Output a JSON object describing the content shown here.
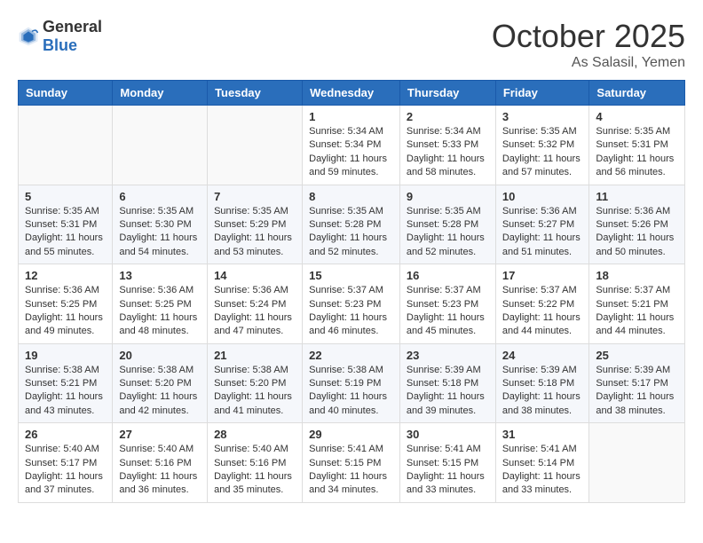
{
  "header": {
    "logo_general": "General",
    "logo_blue": "Blue",
    "month": "October 2025",
    "location": "As Salasil, Yemen"
  },
  "weekdays": [
    "Sunday",
    "Monday",
    "Tuesday",
    "Wednesday",
    "Thursday",
    "Friday",
    "Saturday"
  ],
  "weeks": [
    [
      {
        "day": "",
        "info": ""
      },
      {
        "day": "",
        "info": ""
      },
      {
        "day": "",
        "info": ""
      },
      {
        "day": "1",
        "info": "Sunrise: 5:34 AM\nSunset: 5:34 PM\nDaylight: 11 hours and 59 minutes."
      },
      {
        "day": "2",
        "info": "Sunrise: 5:34 AM\nSunset: 5:33 PM\nDaylight: 11 hours and 58 minutes."
      },
      {
        "day": "3",
        "info": "Sunrise: 5:35 AM\nSunset: 5:32 PM\nDaylight: 11 hours and 57 minutes."
      },
      {
        "day": "4",
        "info": "Sunrise: 5:35 AM\nSunset: 5:31 PM\nDaylight: 11 hours and 56 minutes."
      }
    ],
    [
      {
        "day": "5",
        "info": "Sunrise: 5:35 AM\nSunset: 5:31 PM\nDaylight: 11 hours and 55 minutes."
      },
      {
        "day": "6",
        "info": "Sunrise: 5:35 AM\nSunset: 5:30 PM\nDaylight: 11 hours and 54 minutes."
      },
      {
        "day": "7",
        "info": "Sunrise: 5:35 AM\nSunset: 5:29 PM\nDaylight: 11 hours and 53 minutes."
      },
      {
        "day": "8",
        "info": "Sunrise: 5:35 AM\nSunset: 5:28 PM\nDaylight: 11 hours and 52 minutes."
      },
      {
        "day": "9",
        "info": "Sunrise: 5:35 AM\nSunset: 5:28 PM\nDaylight: 11 hours and 52 minutes."
      },
      {
        "day": "10",
        "info": "Sunrise: 5:36 AM\nSunset: 5:27 PM\nDaylight: 11 hours and 51 minutes."
      },
      {
        "day": "11",
        "info": "Sunrise: 5:36 AM\nSunset: 5:26 PM\nDaylight: 11 hours and 50 minutes."
      }
    ],
    [
      {
        "day": "12",
        "info": "Sunrise: 5:36 AM\nSunset: 5:25 PM\nDaylight: 11 hours and 49 minutes."
      },
      {
        "day": "13",
        "info": "Sunrise: 5:36 AM\nSunset: 5:25 PM\nDaylight: 11 hours and 48 minutes."
      },
      {
        "day": "14",
        "info": "Sunrise: 5:36 AM\nSunset: 5:24 PM\nDaylight: 11 hours and 47 minutes."
      },
      {
        "day": "15",
        "info": "Sunrise: 5:37 AM\nSunset: 5:23 PM\nDaylight: 11 hours and 46 minutes."
      },
      {
        "day": "16",
        "info": "Sunrise: 5:37 AM\nSunset: 5:23 PM\nDaylight: 11 hours and 45 minutes."
      },
      {
        "day": "17",
        "info": "Sunrise: 5:37 AM\nSunset: 5:22 PM\nDaylight: 11 hours and 44 minutes."
      },
      {
        "day": "18",
        "info": "Sunrise: 5:37 AM\nSunset: 5:21 PM\nDaylight: 11 hours and 44 minutes."
      }
    ],
    [
      {
        "day": "19",
        "info": "Sunrise: 5:38 AM\nSunset: 5:21 PM\nDaylight: 11 hours and 43 minutes."
      },
      {
        "day": "20",
        "info": "Sunrise: 5:38 AM\nSunset: 5:20 PM\nDaylight: 11 hours and 42 minutes."
      },
      {
        "day": "21",
        "info": "Sunrise: 5:38 AM\nSunset: 5:20 PM\nDaylight: 11 hours and 41 minutes."
      },
      {
        "day": "22",
        "info": "Sunrise: 5:38 AM\nSunset: 5:19 PM\nDaylight: 11 hours and 40 minutes."
      },
      {
        "day": "23",
        "info": "Sunrise: 5:39 AM\nSunset: 5:18 PM\nDaylight: 11 hours and 39 minutes."
      },
      {
        "day": "24",
        "info": "Sunrise: 5:39 AM\nSunset: 5:18 PM\nDaylight: 11 hours and 38 minutes."
      },
      {
        "day": "25",
        "info": "Sunrise: 5:39 AM\nSunset: 5:17 PM\nDaylight: 11 hours and 38 minutes."
      }
    ],
    [
      {
        "day": "26",
        "info": "Sunrise: 5:40 AM\nSunset: 5:17 PM\nDaylight: 11 hours and 37 minutes."
      },
      {
        "day": "27",
        "info": "Sunrise: 5:40 AM\nSunset: 5:16 PM\nDaylight: 11 hours and 36 minutes."
      },
      {
        "day": "28",
        "info": "Sunrise: 5:40 AM\nSunset: 5:16 PM\nDaylight: 11 hours and 35 minutes."
      },
      {
        "day": "29",
        "info": "Sunrise: 5:41 AM\nSunset: 5:15 PM\nDaylight: 11 hours and 34 minutes."
      },
      {
        "day": "30",
        "info": "Sunrise: 5:41 AM\nSunset: 5:15 PM\nDaylight: 11 hours and 33 minutes."
      },
      {
        "day": "31",
        "info": "Sunrise: 5:41 AM\nSunset: 5:14 PM\nDaylight: 11 hours and 33 minutes."
      },
      {
        "day": "",
        "info": ""
      }
    ]
  ]
}
